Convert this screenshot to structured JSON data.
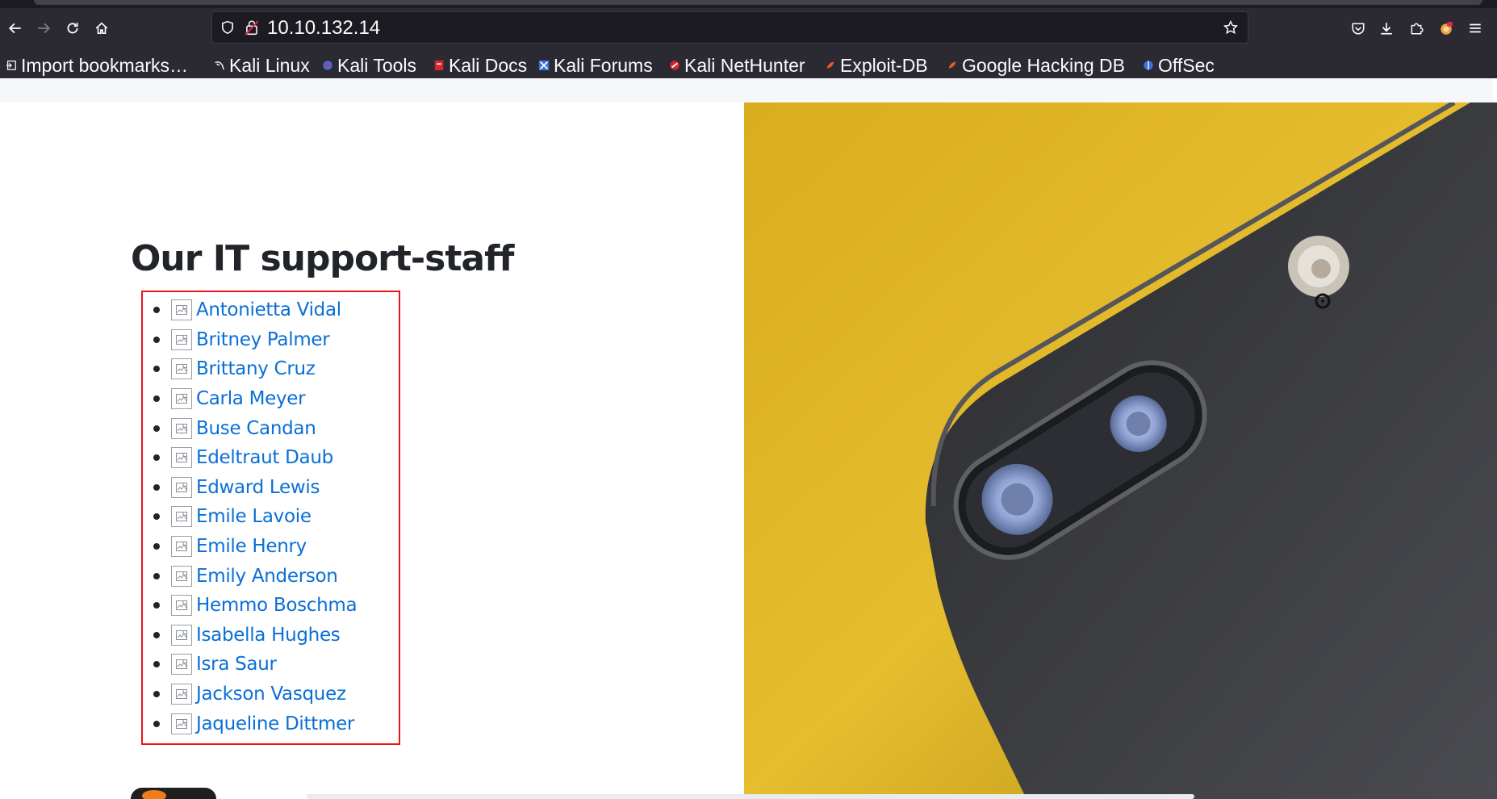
{
  "browser": {
    "url": "10.10.132.14",
    "bookmarks": [
      {
        "label": "Import bookmarks…",
        "icon": "import-icon"
      },
      {
        "label": "Kali Linux",
        "icon": "kali-dragon-icon"
      },
      {
        "label": "Kali Tools",
        "icon": "kali-tools-icon"
      },
      {
        "label": "Kali Docs",
        "icon": "kali-docs-icon"
      },
      {
        "label": "Kali Forums",
        "icon": "kali-forums-icon"
      },
      {
        "label": "Kali NetHunter",
        "icon": "kali-nethunter-icon"
      },
      {
        "label": "Exploit-DB",
        "icon": "exploit-db-icon"
      },
      {
        "label": "Google Hacking DB",
        "icon": "ghdb-icon"
      },
      {
        "label": "OffSec",
        "icon": "offsec-icon"
      }
    ]
  },
  "page": {
    "heading": "Our IT support-staff",
    "staff": [
      "Antonietta Vidal",
      "Britney Palmer",
      "Brittany Cruz",
      "Carla Meyer",
      "Buse Candan",
      "Edeltraut Daub",
      "Edward Lewis",
      "Emile Lavoie",
      "Emile Henry",
      "Emily Anderson",
      "Hemmo Boschma",
      "Isabella Hughes",
      "Isra Saur",
      "Jackson Vasquez",
      "Jaqueline Dittmer"
    ]
  },
  "colors": {
    "link": "#0a6fd6",
    "highlight_box": "#e8161b",
    "chrome_bg": "#2b2a33"
  }
}
